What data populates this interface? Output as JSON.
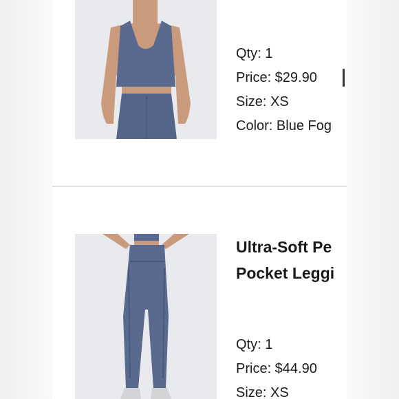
{
  "items": [
    {
      "image_icon": "sports-bra-photo",
      "qty": "Qty: 1",
      "price": "Price: $29.90",
      "size": "Size: XS",
      "color": "Color: Blue Fog"
    },
    {
      "image_icon": "leggings-photo",
      "title_line1": "Ultra-Soft Pe",
      "title_line2": "Pocket Leggi",
      "qty": "Qty: 1",
      "price": "Price: $44.90",
      "size": "Size: XS"
    }
  ],
  "colors": {
    "garment": "#5a6a8e",
    "skin": "#c99a7c",
    "photo_bg": "#e9eaee"
  }
}
